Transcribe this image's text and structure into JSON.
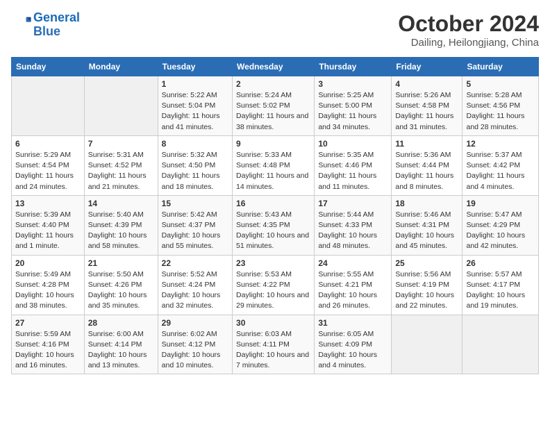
{
  "header": {
    "logo_line1": "General",
    "logo_line2": "Blue",
    "month": "October 2024",
    "location": "Dailing, Heilongjiang, China"
  },
  "days_of_week": [
    "Sunday",
    "Monday",
    "Tuesday",
    "Wednesday",
    "Thursday",
    "Friday",
    "Saturday"
  ],
  "weeks": [
    [
      {
        "day": "",
        "info": ""
      },
      {
        "day": "",
        "info": ""
      },
      {
        "day": "1",
        "info": "Sunrise: 5:22 AM\nSunset: 5:04 PM\nDaylight: 11 hours and 41 minutes."
      },
      {
        "day": "2",
        "info": "Sunrise: 5:24 AM\nSunset: 5:02 PM\nDaylight: 11 hours and 38 minutes."
      },
      {
        "day": "3",
        "info": "Sunrise: 5:25 AM\nSunset: 5:00 PM\nDaylight: 11 hours and 34 minutes."
      },
      {
        "day": "4",
        "info": "Sunrise: 5:26 AM\nSunset: 4:58 PM\nDaylight: 11 hours and 31 minutes."
      },
      {
        "day": "5",
        "info": "Sunrise: 5:28 AM\nSunset: 4:56 PM\nDaylight: 11 hours and 28 minutes."
      }
    ],
    [
      {
        "day": "6",
        "info": "Sunrise: 5:29 AM\nSunset: 4:54 PM\nDaylight: 11 hours and 24 minutes."
      },
      {
        "day": "7",
        "info": "Sunrise: 5:31 AM\nSunset: 4:52 PM\nDaylight: 11 hours and 21 minutes."
      },
      {
        "day": "8",
        "info": "Sunrise: 5:32 AM\nSunset: 4:50 PM\nDaylight: 11 hours and 18 minutes."
      },
      {
        "day": "9",
        "info": "Sunrise: 5:33 AM\nSunset: 4:48 PM\nDaylight: 11 hours and 14 minutes."
      },
      {
        "day": "10",
        "info": "Sunrise: 5:35 AM\nSunset: 4:46 PM\nDaylight: 11 hours and 11 minutes."
      },
      {
        "day": "11",
        "info": "Sunrise: 5:36 AM\nSunset: 4:44 PM\nDaylight: 11 hours and 8 minutes."
      },
      {
        "day": "12",
        "info": "Sunrise: 5:37 AM\nSunset: 4:42 PM\nDaylight: 11 hours and 4 minutes."
      }
    ],
    [
      {
        "day": "13",
        "info": "Sunrise: 5:39 AM\nSunset: 4:40 PM\nDaylight: 11 hours and 1 minute."
      },
      {
        "day": "14",
        "info": "Sunrise: 5:40 AM\nSunset: 4:39 PM\nDaylight: 10 hours and 58 minutes."
      },
      {
        "day": "15",
        "info": "Sunrise: 5:42 AM\nSunset: 4:37 PM\nDaylight: 10 hours and 55 minutes."
      },
      {
        "day": "16",
        "info": "Sunrise: 5:43 AM\nSunset: 4:35 PM\nDaylight: 10 hours and 51 minutes."
      },
      {
        "day": "17",
        "info": "Sunrise: 5:44 AM\nSunset: 4:33 PM\nDaylight: 10 hours and 48 minutes."
      },
      {
        "day": "18",
        "info": "Sunrise: 5:46 AM\nSunset: 4:31 PM\nDaylight: 10 hours and 45 minutes."
      },
      {
        "day": "19",
        "info": "Sunrise: 5:47 AM\nSunset: 4:29 PM\nDaylight: 10 hours and 42 minutes."
      }
    ],
    [
      {
        "day": "20",
        "info": "Sunrise: 5:49 AM\nSunset: 4:28 PM\nDaylight: 10 hours and 38 minutes."
      },
      {
        "day": "21",
        "info": "Sunrise: 5:50 AM\nSunset: 4:26 PM\nDaylight: 10 hours and 35 minutes."
      },
      {
        "day": "22",
        "info": "Sunrise: 5:52 AM\nSunset: 4:24 PM\nDaylight: 10 hours and 32 minutes."
      },
      {
        "day": "23",
        "info": "Sunrise: 5:53 AM\nSunset: 4:22 PM\nDaylight: 10 hours and 29 minutes."
      },
      {
        "day": "24",
        "info": "Sunrise: 5:55 AM\nSunset: 4:21 PM\nDaylight: 10 hours and 26 minutes."
      },
      {
        "day": "25",
        "info": "Sunrise: 5:56 AM\nSunset: 4:19 PM\nDaylight: 10 hours and 22 minutes."
      },
      {
        "day": "26",
        "info": "Sunrise: 5:57 AM\nSunset: 4:17 PM\nDaylight: 10 hours and 19 minutes."
      }
    ],
    [
      {
        "day": "27",
        "info": "Sunrise: 5:59 AM\nSunset: 4:16 PM\nDaylight: 10 hours and 16 minutes."
      },
      {
        "day": "28",
        "info": "Sunrise: 6:00 AM\nSunset: 4:14 PM\nDaylight: 10 hours and 13 minutes."
      },
      {
        "day": "29",
        "info": "Sunrise: 6:02 AM\nSunset: 4:12 PM\nDaylight: 10 hours and 10 minutes."
      },
      {
        "day": "30",
        "info": "Sunrise: 6:03 AM\nSunset: 4:11 PM\nDaylight: 10 hours and 7 minutes."
      },
      {
        "day": "31",
        "info": "Sunrise: 6:05 AM\nSunset: 4:09 PM\nDaylight: 10 hours and 4 minutes."
      },
      {
        "day": "",
        "info": ""
      },
      {
        "day": "",
        "info": ""
      }
    ]
  ]
}
